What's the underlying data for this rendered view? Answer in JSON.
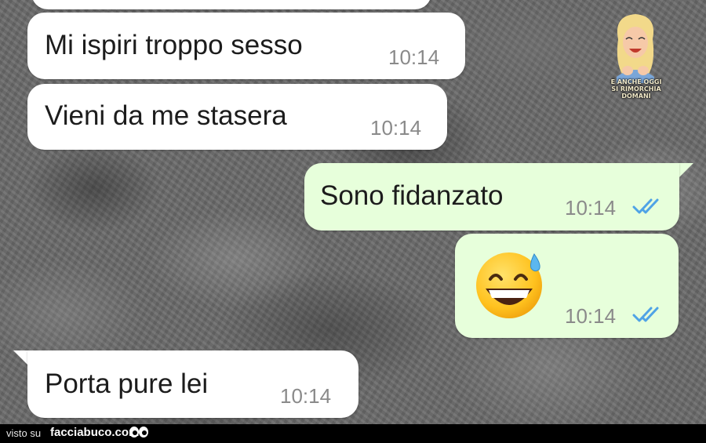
{
  "messages": [
    {
      "text": "",
      "time": ""
    },
    {
      "text": "Mi ispiri troppo sesso",
      "time": "10:14",
      "direction": "incoming"
    },
    {
      "text": "Vieni da me stasera",
      "time": "10:14",
      "direction": "incoming"
    },
    {
      "text": "Sono fidanzato",
      "time": "10:14",
      "direction": "outgoing",
      "read_ticks": "double-check-blue-icon"
    },
    {
      "emoji": "grinning-face-with-sweat-emoji",
      "time": "10:14",
      "direction": "outgoing",
      "read_ticks": "double-check-blue-icon"
    },
    {
      "text": "Porta pure lei",
      "time": "10:14",
      "direction": "incoming"
    }
  ],
  "sticker": {
    "caption_line1": "E ANCHE OGGI",
    "caption_line2": "SI RIMORCHIA DOMANI",
    "icon": "cartoon-woman-sticker"
  },
  "footer": {
    "prefix": "visto su",
    "brand": "facciabuco.com",
    "icon": "eyes-icon"
  },
  "colors": {
    "incoming_bubble": "#ffffff",
    "outgoing_bubble": "#e7ffdb",
    "read_tick": "#4fa3e6",
    "time_text": "#8a8a8a",
    "footer_bg": "#000000"
  }
}
